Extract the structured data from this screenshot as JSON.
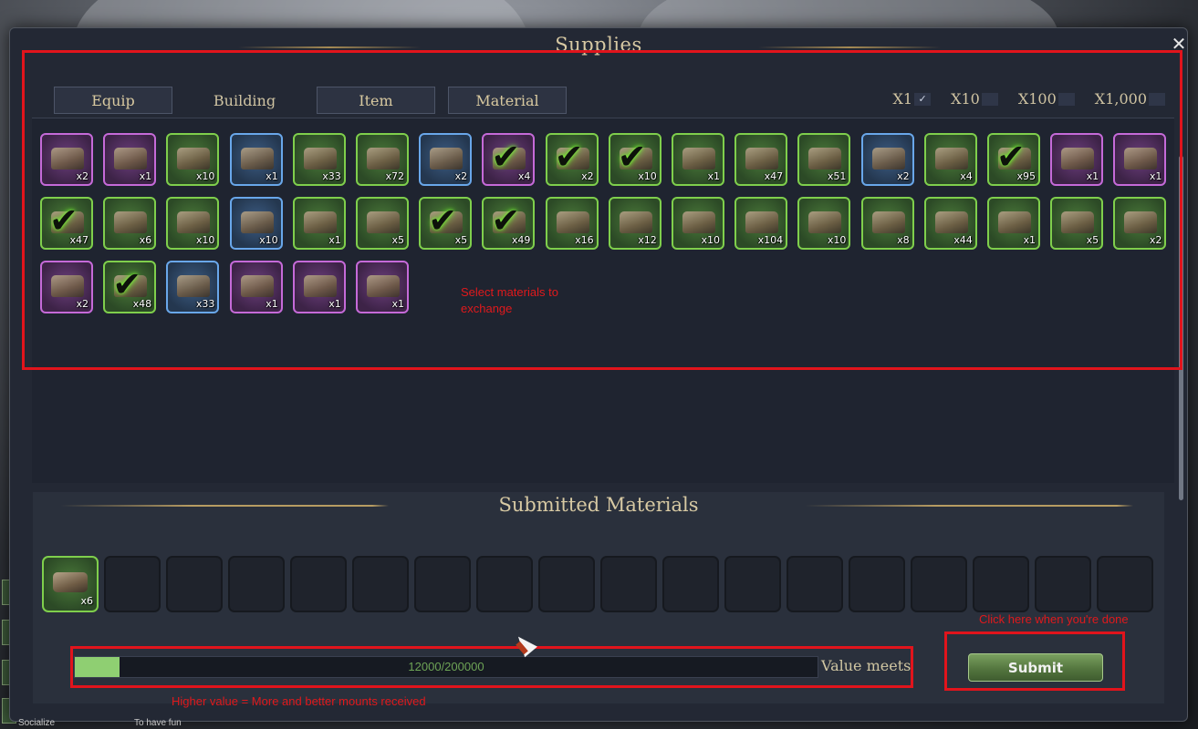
{
  "window": {
    "title": "Supplies",
    "close_label": "✕"
  },
  "tabs": [
    {
      "label": "Equip"
    },
    {
      "label": "Building"
    },
    {
      "label": "Item"
    },
    {
      "label": "Material"
    }
  ],
  "quantity_options": [
    {
      "label": "X1",
      "mark": "✓"
    },
    {
      "label": "X10",
      "mark": ""
    },
    {
      "label": "X100",
      "mark": ""
    },
    {
      "label": "X1,000",
      "mark": ""
    }
  ],
  "materials": [
    {
      "rarity": "purple",
      "count": "x2",
      "checked": false
    },
    {
      "rarity": "purple",
      "count": "x1",
      "checked": false
    },
    {
      "rarity": "green",
      "count": "x10",
      "checked": false
    },
    {
      "rarity": "blue",
      "count": "x1",
      "checked": false
    },
    {
      "rarity": "green",
      "count": "x33",
      "checked": false
    },
    {
      "rarity": "green",
      "count": "x72",
      "checked": false
    },
    {
      "rarity": "blue",
      "count": "x2",
      "checked": false
    },
    {
      "rarity": "purple",
      "count": "x4",
      "checked": true
    },
    {
      "rarity": "green",
      "count": "x2",
      "checked": true
    },
    {
      "rarity": "green",
      "count": "x10",
      "checked": true
    },
    {
      "rarity": "green",
      "count": "x1",
      "checked": false
    },
    {
      "rarity": "green",
      "count": "x47",
      "checked": false
    },
    {
      "rarity": "green",
      "count": "x51",
      "checked": false
    },
    {
      "rarity": "blue",
      "count": "x2",
      "checked": false
    },
    {
      "rarity": "green",
      "count": "x4",
      "checked": false
    },
    {
      "rarity": "green",
      "count": "x95",
      "checked": true
    },
    {
      "rarity": "purple",
      "count": "x1",
      "checked": false
    },
    {
      "rarity": "purple",
      "count": "x1",
      "checked": false
    },
    {
      "rarity": "green",
      "count": "x47",
      "checked": true
    },
    {
      "rarity": "green",
      "count": "x6",
      "checked": false
    },
    {
      "rarity": "green",
      "count": "x10",
      "checked": false
    },
    {
      "rarity": "blue",
      "count": "x10",
      "checked": false
    },
    {
      "rarity": "green",
      "count": "x1",
      "checked": false
    },
    {
      "rarity": "green",
      "count": "x5",
      "checked": false
    },
    {
      "rarity": "green",
      "count": "x5",
      "checked": true
    },
    {
      "rarity": "green",
      "count": "x49",
      "checked": true
    },
    {
      "rarity": "green",
      "count": "x16",
      "checked": false
    },
    {
      "rarity": "green",
      "count": "x12",
      "checked": false
    },
    {
      "rarity": "green",
      "count": "x10",
      "checked": false
    },
    {
      "rarity": "green",
      "count": "x104",
      "checked": false
    },
    {
      "rarity": "green",
      "count": "x10",
      "checked": false
    },
    {
      "rarity": "green",
      "count": "x8",
      "checked": false
    },
    {
      "rarity": "green",
      "count": "x44",
      "checked": false
    },
    {
      "rarity": "green",
      "count": "x1",
      "checked": false
    },
    {
      "rarity": "green",
      "count": "x5",
      "checked": false
    },
    {
      "rarity": "green",
      "count": "x2",
      "checked": false
    },
    {
      "rarity": "purple",
      "count": "x2",
      "checked": false
    },
    {
      "rarity": "green",
      "count": "x48",
      "checked": true
    },
    {
      "rarity": "blue",
      "count": "x33",
      "checked": false
    },
    {
      "rarity": "purple",
      "count": "x1",
      "checked": false
    },
    {
      "rarity": "purple",
      "count": "x1",
      "checked": false
    },
    {
      "rarity": "purple",
      "count": "x1",
      "checked": false
    }
  ],
  "submitted": {
    "title": "Submitted Materials",
    "slots": [
      {
        "filled": true,
        "count": "x6"
      },
      {
        "filled": false
      },
      {
        "filled": false
      },
      {
        "filled": false
      },
      {
        "filled": false
      },
      {
        "filled": false
      },
      {
        "filled": false
      },
      {
        "filled": false
      },
      {
        "filled": false
      },
      {
        "filled": false
      },
      {
        "filled": false
      },
      {
        "filled": false
      },
      {
        "filled": false
      },
      {
        "filled": false
      },
      {
        "filled": false
      },
      {
        "filled": false
      },
      {
        "filled": false
      },
      {
        "filled": false
      }
    ]
  },
  "progress": {
    "current": 12000,
    "target": 200000,
    "text": "12000/200000",
    "label": "Value meets",
    "fill_fraction": 0.06
  },
  "submit_label": "Submit",
  "annotations": {
    "select": "Select materials to exchange",
    "click": "Click here when you're done",
    "higher": "Higher value = More and better mounts received"
  },
  "background_text": {
    "left": "Socialize",
    "mid": "To have fun"
  },
  "colors": {
    "accent_red": "#e1141c",
    "green_border": "#7fcf4c",
    "blue_border": "#69a7ea",
    "purple_border": "#c56ad8"
  }
}
